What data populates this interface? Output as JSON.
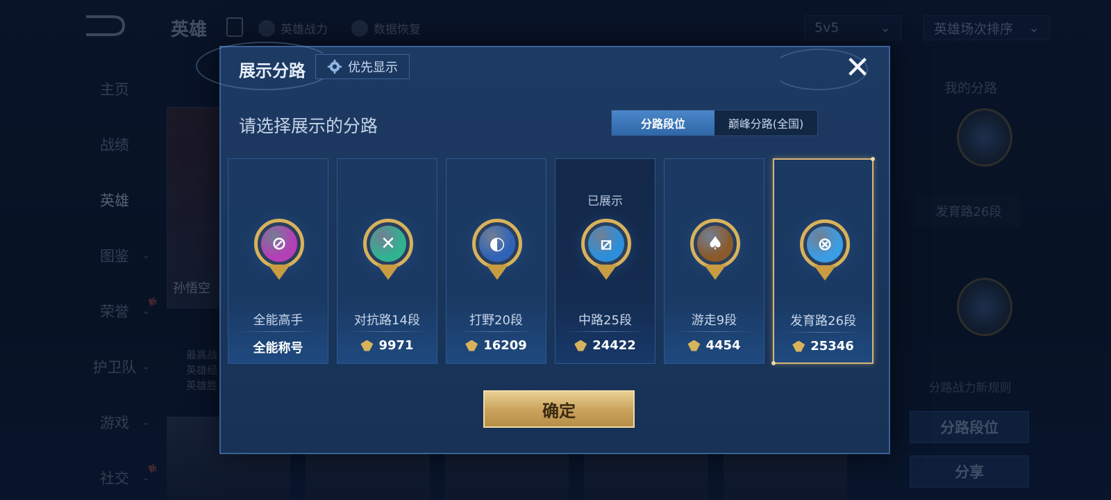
{
  "background": {
    "title": "英雄",
    "topbar": {
      "hero_power": "英雄战力",
      "data_restore": "数据恢复"
    },
    "mode_select": "5v5",
    "sort_select": "英雄场次排序",
    "sidebar": [
      {
        "label": "主页"
      },
      {
        "label": "战绩"
      },
      {
        "label": "英雄"
      },
      {
        "label": "图鉴"
      },
      {
        "label": "荣誉",
        "badge": "新"
      },
      {
        "label": "护卫队"
      },
      {
        "label": "游戏"
      },
      {
        "label": "社交",
        "badge": "新"
      }
    ],
    "hero_card_name": "孙悟空",
    "hero_card_lines": [
      "最高战",
      "英雄经",
      "英雄胜"
    ],
    "right_panel": {
      "title": "我的分路",
      "label": "发育路26段",
      "rules": "分路战力新规则",
      "btn_lane": "分路段位",
      "btn_share": "分享"
    }
  },
  "modal": {
    "title": "展示分路",
    "priority_button": "优先显示",
    "close": "✕",
    "subtitle": "请选择展示的分路",
    "tabs": [
      {
        "label": "分路段位",
        "active": true
      },
      {
        "label": "巅峰分路(全国)",
        "active": false
      }
    ],
    "cards": [
      {
        "name": "全能高手",
        "value": "全能称号",
        "icon": "allround-icon",
        "color": "#b53fb7",
        "glyph": "⊘",
        "show_power": false
      },
      {
        "name": "对抗路14段",
        "value": "9971",
        "icon": "clash-lane-icon",
        "color": "#2fb391",
        "glyph": "✕",
        "show_power": true
      },
      {
        "name": "打野20段",
        "value": "16209",
        "icon": "jungle-icon",
        "color": "#2f63b8",
        "glyph": "◐",
        "show_power": true
      },
      {
        "name": "中路25段",
        "value": "24422",
        "icon": "mid-lane-icon",
        "color": "#2b8fdc",
        "glyph": "⧄",
        "show_power": true,
        "shown_tag": "已展示"
      },
      {
        "name": "游走9段",
        "value": "4454",
        "icon": "roam-icon",
        "color": "#8a5a2b",
        "glyph": "♠",
        "show_power": true
      },
      {
        "name": "发育路26段",
        "value": "25346",
        "icon": "farm-lane-icon",
        "color": "#3a9de6",
        "glyph": "⊗",
        "show_power": true
      }
    ],
    "confirm": "确定"
  }
}
